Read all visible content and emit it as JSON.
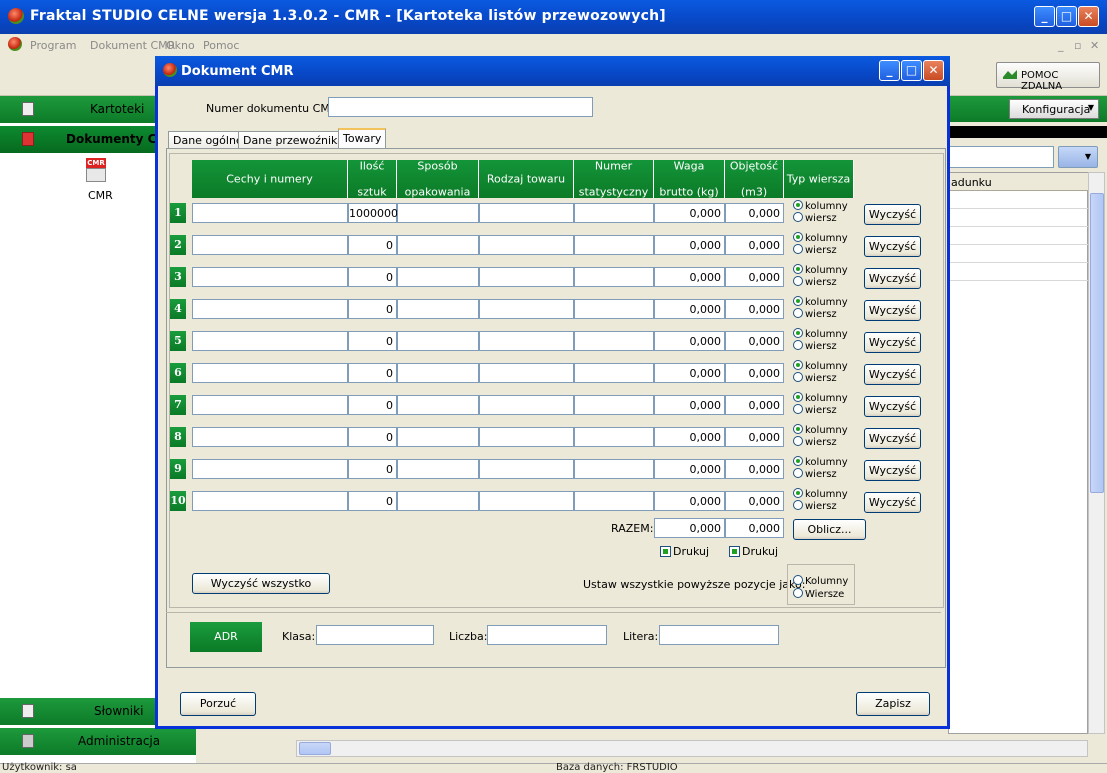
{
  "main_window": {
    "title": "Fraktal STUDIO CELNE  wersja 1.3.0.2 - CMR - [Kartoteka listów przewozowych]"
  },
  "menu": [
    "Program",
    "Dokument CMR",
    "Okno",
    "Pomoc"
  ],
  "toolbar": {
    "remote_help": "POMOC ZDALNA",
    "config": "Konfiguracja"
  },
  "sidebar": {
    "kartoteki": "Kartoteki",
    "dokumenty": "Dokumenty CMR",
    "cmr_icon_label": "CMR",
    "slowniki": "Słowniki",
    "administracja": "Administracja"
  },
  "right_list": {
    "header": "adunku"
  },
  "statusbar": {
    "user": "Użytkownik: sa",
    "db": "Baza danych: FRSTUDIO"
  },
  "dialog": {
    "title": "Dokument CMR",
    "doc_number_label": "Numer dokumentu CMR:",
    "doc_number_value": "",
    "tabs": [
      "Dane ogólne",
      "Dane przewoźnika",
      "Towary"
    ],
    "columns": {
      "cechy": "Cechy i numery",
      "ilosc_1": "Ilość",
      "ilosc_2": "sztuk",
      "sposob_1": "Sposób",
      "sposob_2": "opakowania",
      "rodzaj": "Rodzaj towaru",
      "numer_1": "Numer",
      "numer_2": "statystyczny",
      "waga_1": "Waga",
      "waga_2": "brutto (kg)",
      "obj_1": "Objętość",
      "obj_2": "(m3)",
      "typ": "Typ wiersza"
    },
    "rows": [
      {
        "n": "1",
        "qty": "1000000",
        "weight": "0,000",
        "volume": "0,000"
      },
      {
        "n": "2",
        "qty": "0",
        "weight": "0,000",
        "volume": "0,000"
      },
      {
        "n": "3",
        "qty": "0",
        "weight": "0,000",
        "volume": "0,000"
      },
      {
        "n": "4",
        "qty": "0",
        "weight": "0,000",
        "volume": "0,000"
      },
      {
        "n": "5",
        "qty": "0",
        "weight": "0,000",
        "volume": "0,000"
      },
      {
        "n": "6",
        "qty": "0",
        "weight": "0,000",
        "volume": "0,000"
      },
      {
        "n": "7",
        "qty": "0",
        "weight": "0,000",
        "volume": "0,000"
      },
      {
        "n": "8",
        "qty": "0",
        "weight": "0,000",
        "volume": "0,000"
      },
      {
        "n": "9",
        "qty": "0",
        "weight": "0,000",
        "volume": "0,000"
      },
      {
        "n": "10",
        "qty": "0",
        "weight": "0,000",
        "volume": "0,000"
      }
    ],
    "radio_kolumny": "kolumny",
    "radio_wiersz": "wiersz",
    "clear_row": "Wyczyść",
    "razem_label": "RAZEM:",
    "razem_weight": "0,000",
    "razem_volume": "0,000",
    "oblicz": "Oblicz...",
    "drukuj": "Drukuj",
    "clear_all": "Wyczyść wszystko",
    "set_all_label": "Ustaw wszystkie powyższe pozycje jako:",
    "set_kolumny": "Kolumny",
    "set_wiersze": "Wiersze",
    "adr": "ADR",
    "klasa": "Klasa:",
    "liczba": "Liczba:",
    "litera": "Litera:",
    "porzuc": "Porzuć",
    "zapisz": "Zapisz"
  }
}
